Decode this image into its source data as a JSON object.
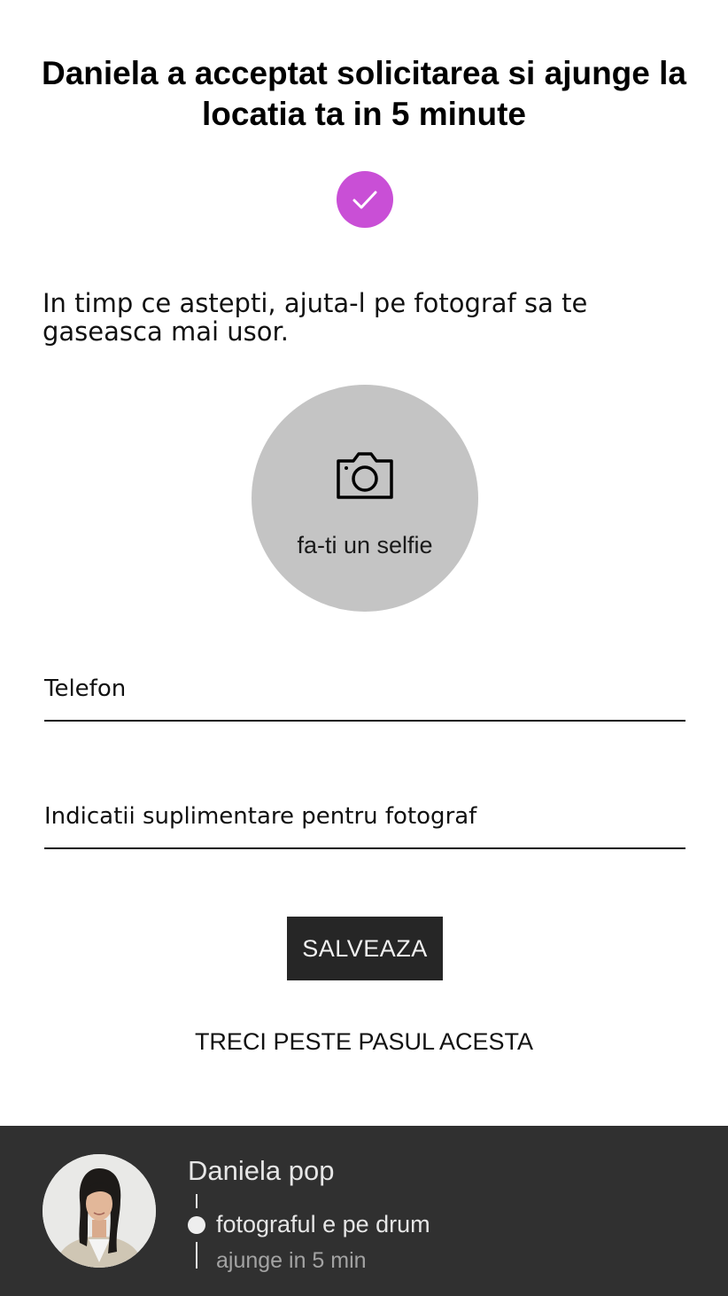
{
  "header": {
    "title": "Daniela a acceptat solicitarea si ajunge la locatia ta in 5 minute",
    "confirm_icon": "checkmark-icon",
    "accent_color": "#c94fd6"
  },
  "intro_text": "In timp ce astepti, ajuta-l pe fotograf sa te gaseasca mai usor.",
  "selfie": {
    "icon": "camera-icon",
    "label": "fa-ti un selfie"
  },
  "form": {
    "phone_placeholder": "Telefon",
    "notes_placeholder": "Indicatii suplimentare pentru fotograf"
  },
  "actions": {
    "save_label": "SALVEAZA",
    "skip_label": "TRECI PESTE PASUL ACESTA"
  },
  "photographer": {
    "name": "Daniela pop",
    "status": "fotograful e pe drum",
    "eta": "ajunge in 5 min"
  }
}
